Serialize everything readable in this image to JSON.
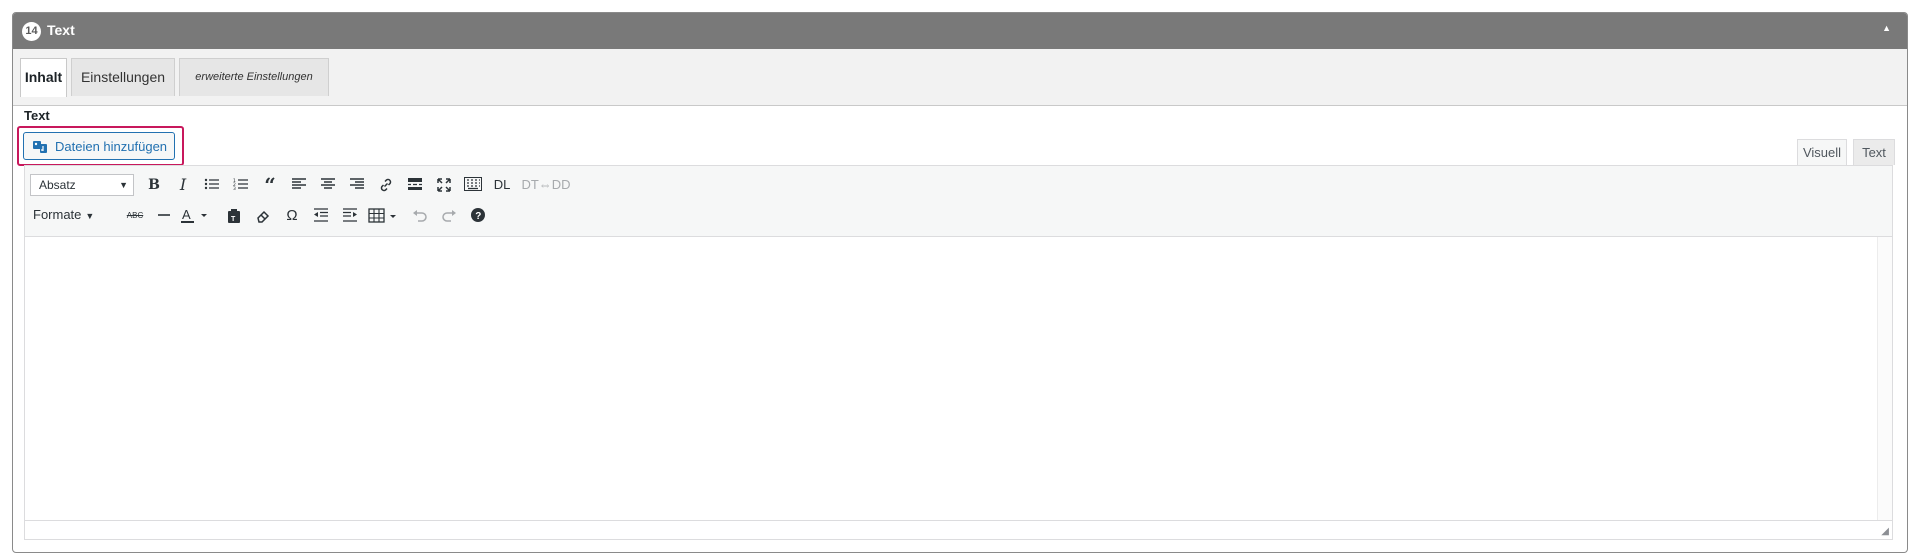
{
  "panel": {
    "badge": "14",
    "title": "Text",
    "collapse_icon": "caret-up-icon"
  },
  "tabs": [
    {
      "label": "Inhalt",
      "active": true
    },
    {
      "label": "Einstellungen",
      "active": false
    },
    {
      "label": "erweiterte Einstellungen",
      "active": false
    }
  ],
  "field_label": "Text",
  "add_media_button": "Dateien hinzufügen",
  "editor_modes": [
    {
      "label": "Visuell",
      "active": true
    },
    {
      "label": "Text",
      "active": false
    }
  ],
  "toolbar": {
    "format_select": "Absatz",
    "formats_menu": "Formate",
    "dl_button": "DL",
    "dtdd_button": "DT⇔DD"
  },
  "colors": {
    "header_bg": "#797979",
    "accent": "#2271b1",
    "highlight": "#c8185c"
  }
}
